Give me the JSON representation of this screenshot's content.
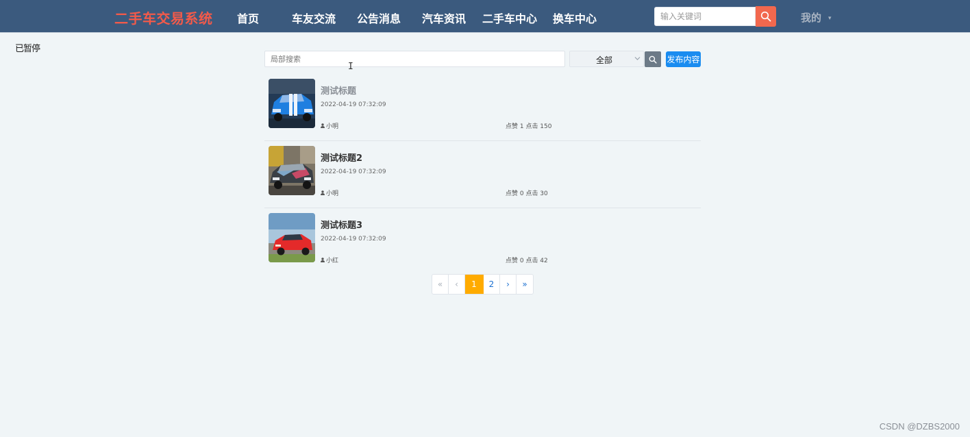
{
  "nav": {
    "brand": "二手车交易系统",
    "items": [
      {
        "label": "首页"
      },
      {
        "label": "车友交流"
      },
      {
        "label": "公告消息"
      },
      {
        "label": "汽车资讯"
      },
      {
        "label": "二手车中心"
      },
      {
        "label": "换车中心"
      }
    ],
    "search_placeholder": "输入关键词",
    "account_label": "我的"
  },
  "corner_text": "已暂停",
  "toolbar": {
    "search_placeholder": "局部搜索",
    "filter_value": "全部",
    "publish_label": "发布内容"
  },
  "posts": [
    {
      "title": "测试标题",
      "date": "2022-04-19 07:32:09",
      "author": "小明",
      "stats": "点赞 1 点击 150"
    },
    {
      "title": "测试标题2",
      "date": "2022-04-19 07:32:09",
      "author": "小明",
      "stats": "点赞 0 点击 30"
    },
    {
      "title": "测试标题3",
      "date": "2022-04-19 07:32:09",
      "author": "小红",
      "stats": "点赞 0 点击 42"
    }
  ],
  "pagination": {
    "first": "«",
    "prev": "‹",
    "pages": [
      "1",
      "2"
    ],
    "current": "1",
    "next": "›",
    "last": "»"
  },
  "watermark": "CSDN @DZBS2000",
  "colors": {
    "navbar": "#3b5a7e",
    "brand": "#f25a4a",
    "search_button": "#f2684e",
    "publish_button": "#1a8cf0",
    "active_page": "#ffab00"
  }
}
